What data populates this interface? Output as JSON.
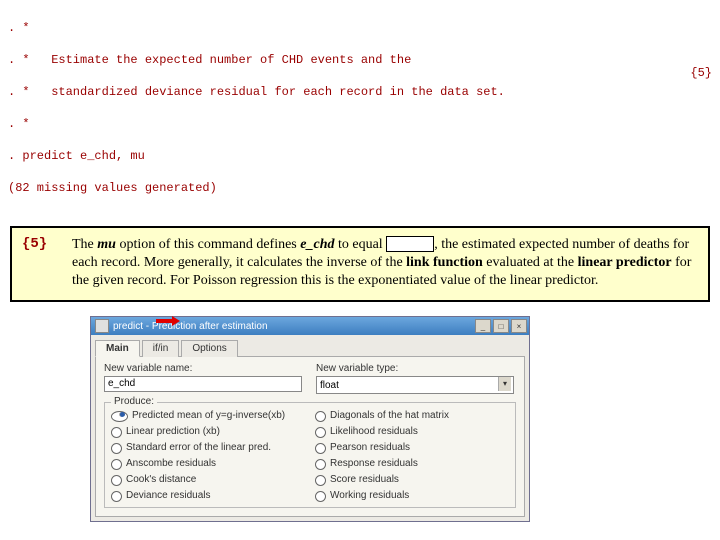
{
  "code": {
    "l1": ". *",
    "l2": ". *   Estimate the expected number of CHD events and the",
    "l3": ". *   standardized deviance residual for each record in the data set.",
    "l4": ". *",
    "l5": ". predict e_chd, mu",
    "l6": "(82 missing values generated)",
    "rightRef": "{5}"
  },
  "note": {
    "ref": "{5}",
    "text_a": "The ",
    "mu": "mu",
    "text_b": " option of this command defines ",
    "echd": "e_chd",
    "text_c": " to equal ",
    "text_d": ", the estimated expected number of deaths for each record.  More generally, it calculates the inverse of the ",
    "link": "link function",
    "text_e": " evaluated at the ",
    "linpred": "linear predictor",
    "text_f": " for the given record.  For Poisson regression this is the exponentiated value of the linear predictor."
  },
  "dialog": {
    "title": "predict - Prediction after estimation",
    "closeBtn": "×",
    "maxBtn": "□",
    "minBtn": "_",
    "tabs": {
      "main": "Main",
      "ifin": "if/in",
      "options": "Options"
    },
    "varname_label": "New variable name:",
    "varname_value": "e_chd",
    "vartype_label": "New variable type:",
    "vartype_value": "float",
    "group_legend": "Produce:",
    "left": {
      "r1": "Predicted mean of y=g-inverse(xb)",
      "r2": "Linear prediction (xb)",
      "r3": "Standard error of the linear pred.",
      "r4": "Anscombe residuals",
      "r5": "Cook's distance",
      "r6": "Deviance residuals"
    },
    "right": {
      "r1": "Diagonals of the hat matrix",
      "r2": "Likelihood residuals",
      "r3": "Pearson residuals",
      "r4": "Response residuals",
      "r5": "Score residuals",
      "r6": "Working residuals"
    }
  }
}
